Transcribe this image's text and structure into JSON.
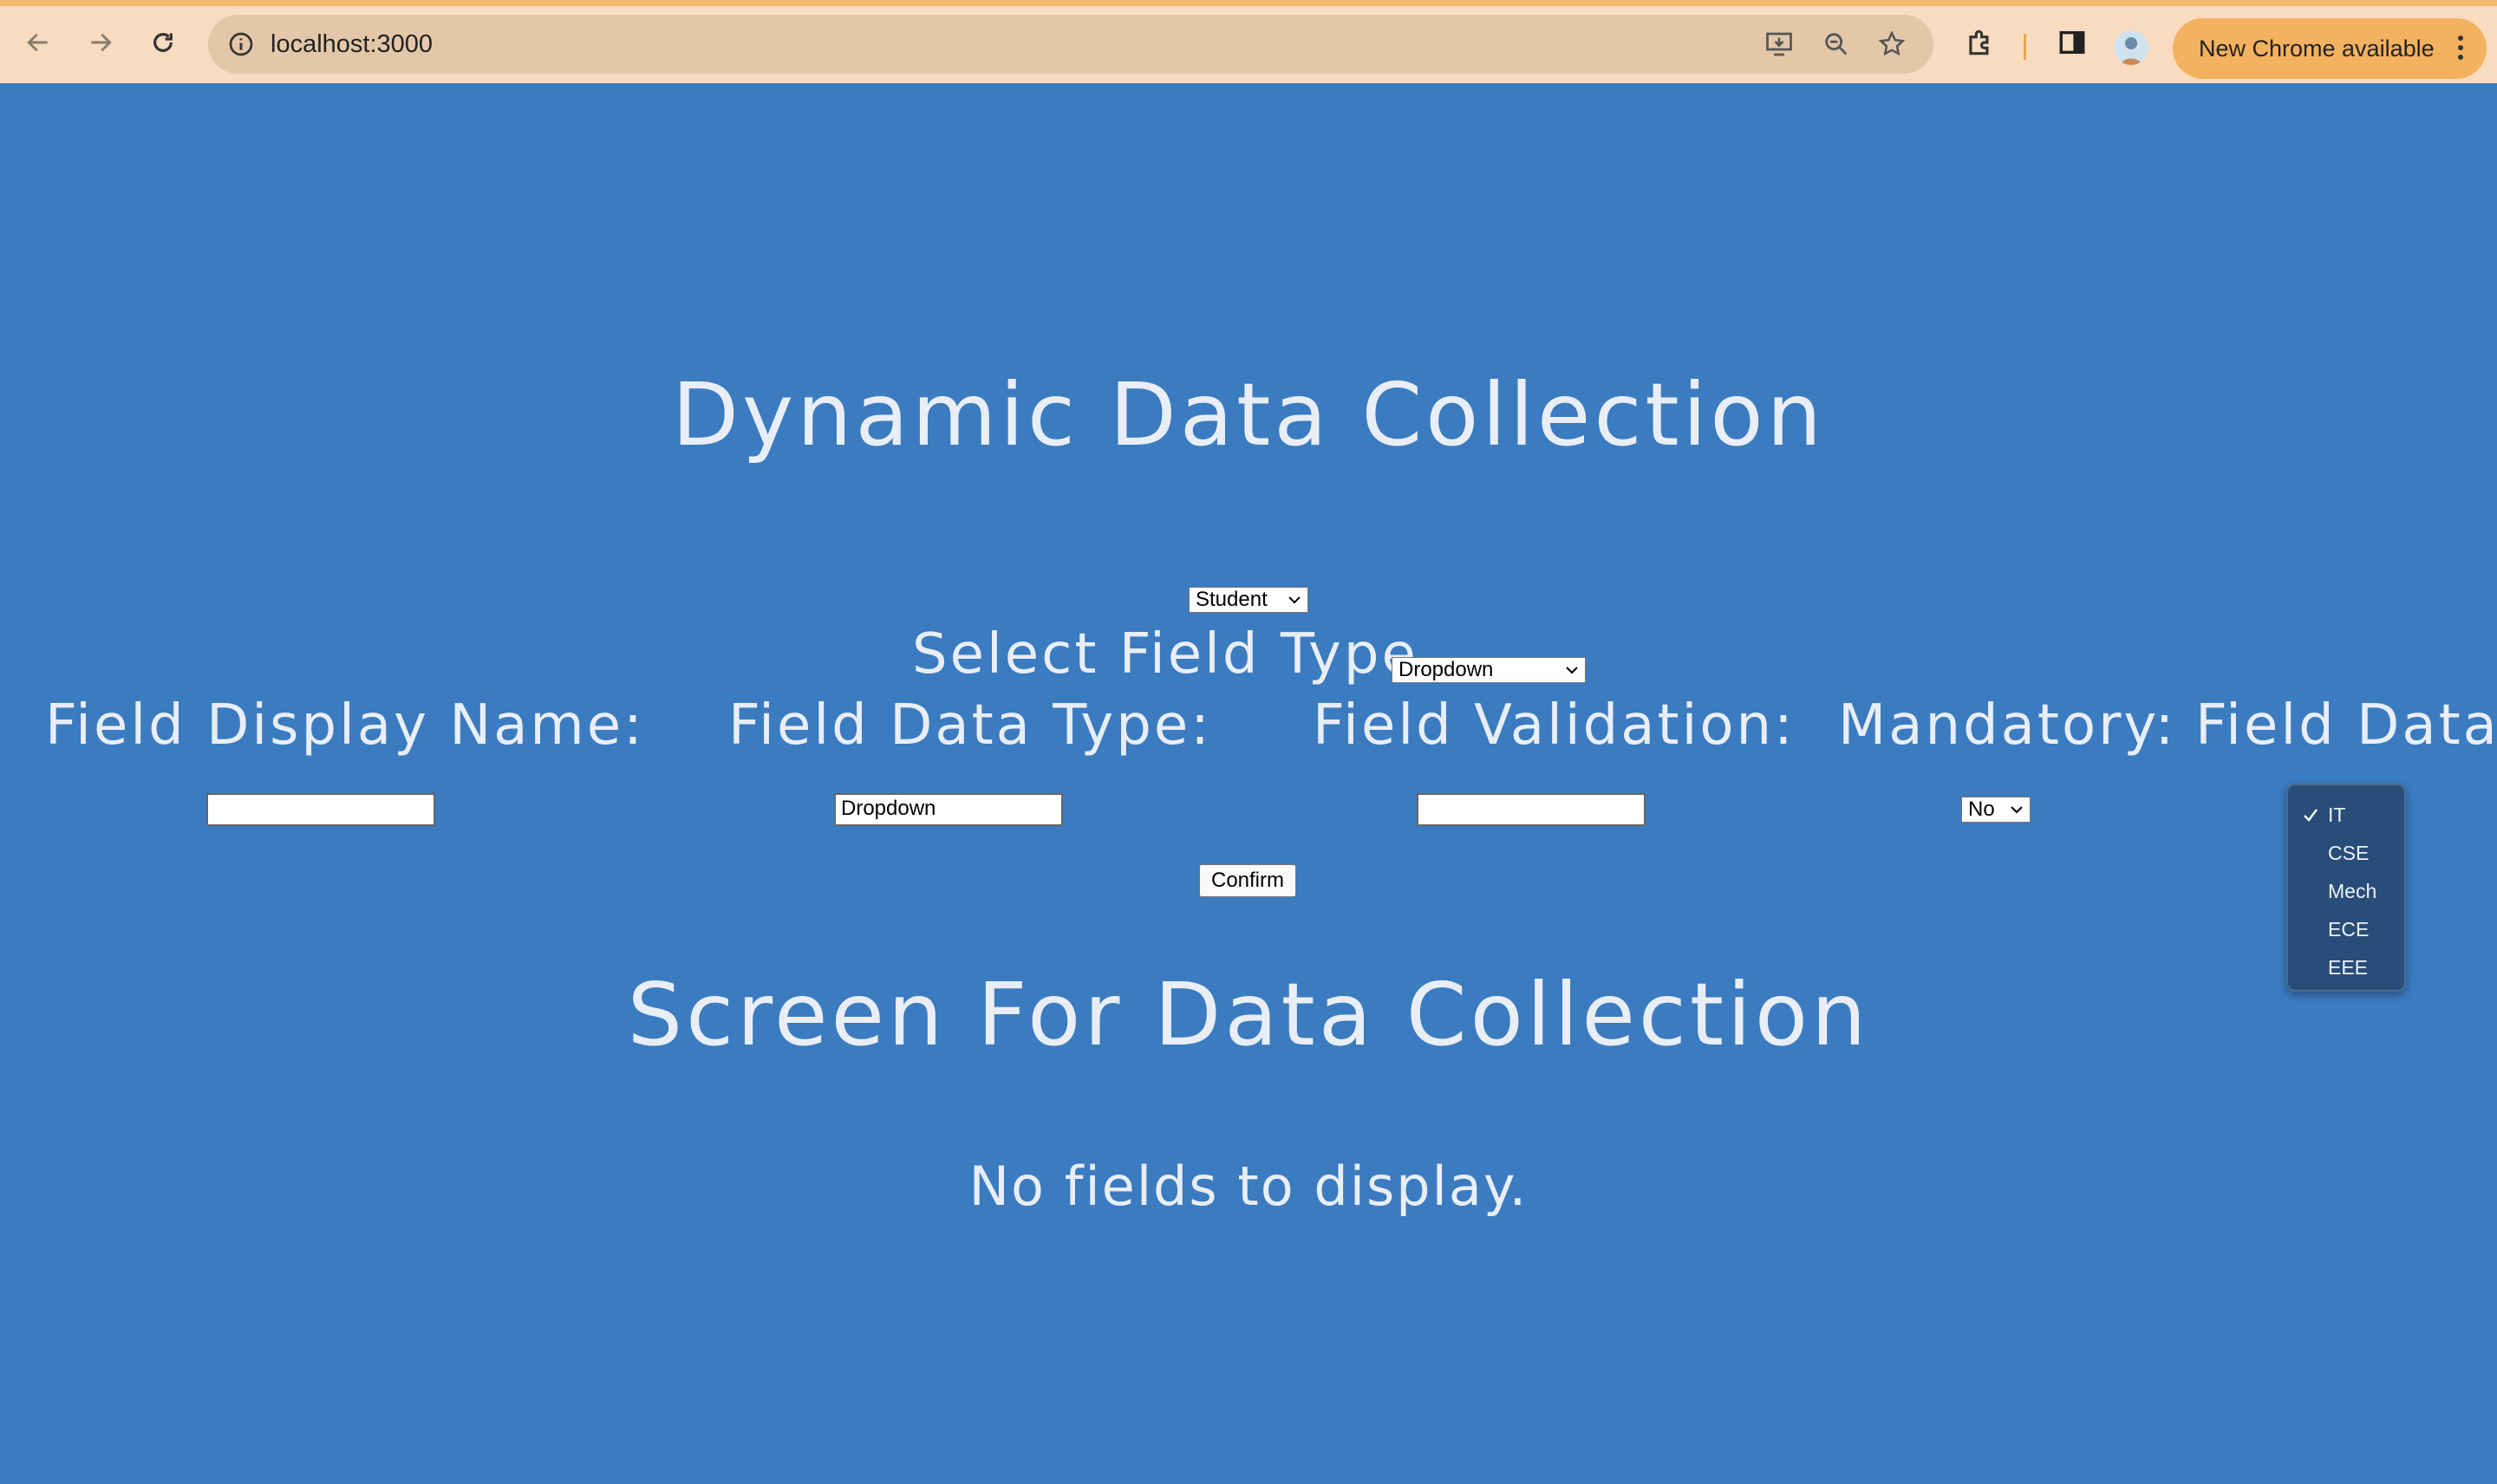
{
  "browser": {
    "url": "localhost:3000",
    "update_button": "New Chrome available"
  },
  "page": {
    "title": "Dynamic Data Collection",
    "entity_select": "Student",
    "field_type_label": "Select Field Type",
    "field_type_select": "Dropdown",
    "columns": {
      "display_name": "Field Display Name:",
      "data_type": "Field Data Type:",
      "validation": "Field Validation:",
      "mandatory": "Mandatory:",
      "field_data": "Field Data:"
    },
    "inputs": {
      "display_name_value": "",
      "data_type_value": "Dropdown",
      "validation_value": "",
      "mandatory_value": "No"
    },
    "field_data_options": [
      "IT",
      "CSE",
      "Mech",
      "ECE",
      "EEE"
    ],
    "field_data_selected": "IT",
    "confirm_label": "Confirm",
    "screen_title": "Screen For Data Collection",
    "empty_message": "No fields to display."
  }
}
